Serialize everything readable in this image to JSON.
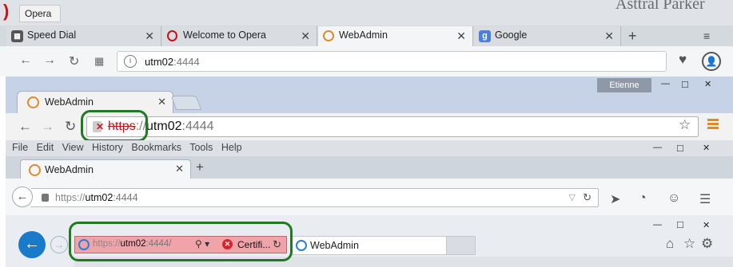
{
  "opera": {
    "app_title": "Opera",
    "background_text": "Asttral Parker",
    "tabs": [
      {
        "label": "Speed Dial",
        "active": false
      },
      {
        "label": "Welcome to Opera",
        "active": false
      },
      {
        "label": "WebAdmin",
        "active": true
      },
      {
        "label": "Google",
        "active": false
      }
    ],
    "new_tab": "+",
    "menu_glyph": "≡",
    "url": {
      "host": "utm02",
      "port": ":4444"
    }
  },
  "chrome": {
    "profile": "Etienne",
    "window_controls": {
      "min": "—",
      "max": "□",
      "close": "✕"
    },
    "tab_title": "WebAdmin",
    "url": {
      "scheme": "https",
      "sep": "://",
      "host": "utm02",
      "port": ":4444"
    }
  },
  "firefox": {
    "menu": [
      "File",
      "Edit",
      "View",
      "History",
      "Bookmarks",
      "Tools",
      "Help"
    ],
    "window_controls": {
      "min": "—",
      "max": "□",
      "close": "✕"
    },
    "tab_title": "WebAdmin",
    "new_tab": "+",
    "url": {
      "scheme": "https://",
      "host": "utm02",
      "port": ":4444"
    }
  },
  "ie": {
    "window_controls": {
      "min": "—",
      "max": "□",
      "close": "✕"
    },
    "url": {
      "scheme": "https://",
      "host": "utm02",
      "port": ":4444/"
    },
    "cert_label": "Certifi...",
    "tab_title": "WebAdmin"
  },
  "colors": {
    "highlight_circle": "#217a21",
    "ie_cert_error_bg": "#f0a4aa",
    "chrome_https_struck": "#c01818",
    "ie_back_blue": "#1979ca"
  }
}
